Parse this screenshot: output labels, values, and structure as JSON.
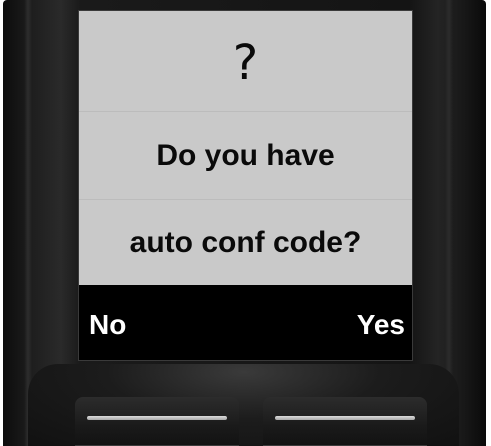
{
  "screen": {
    "icon": "?",
    "icon_name": "question-mark-icon",
    "message_line1": "Do you have",
    "message_line2": "auto conf code?",
    "background_color": "#c9c9c9"
  },
  "softkeys": {
    "left_label": "No",
    "right_label": "Yes",
    "bar_color": "#000000",
    "label_color": "#ffffff"
  }
}
